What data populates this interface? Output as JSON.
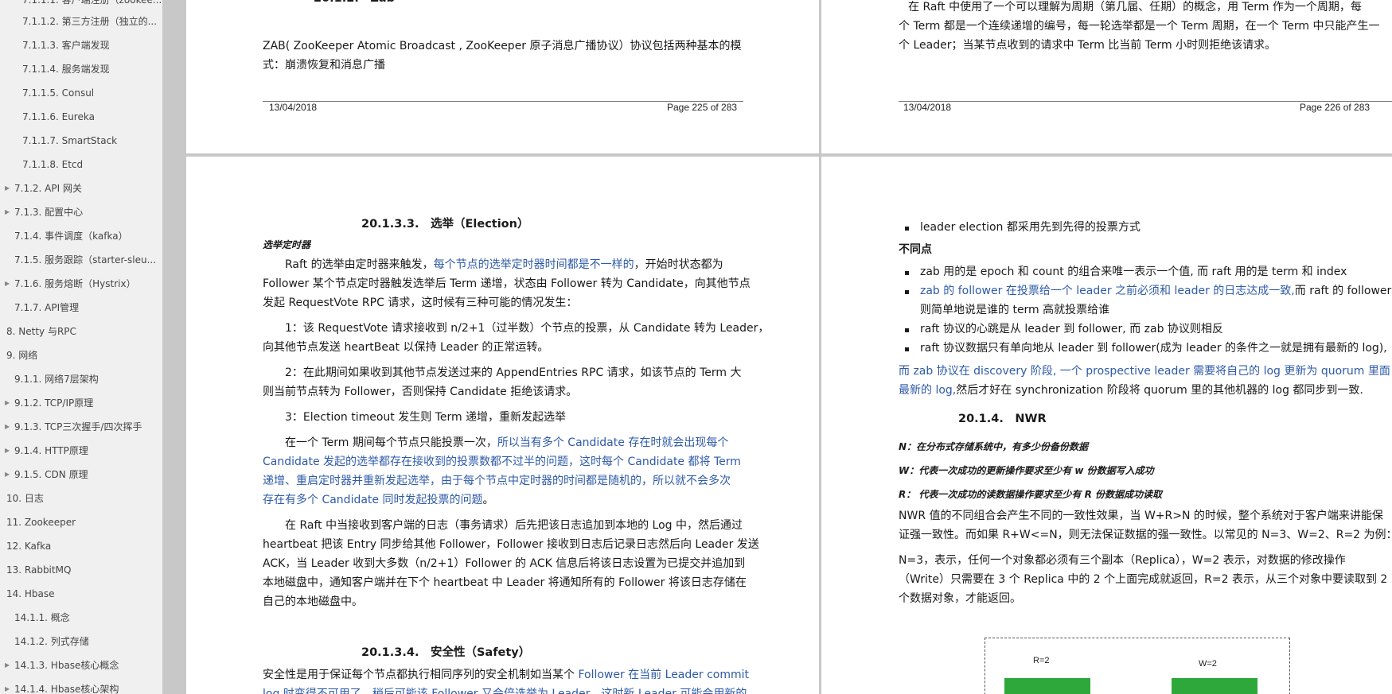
{
  "sidebar": {
    "items": [
      {
        "label": "7.1.1.2. 第三方注册（独立的...",
        "arrow": false
      },
      {
        "label": "7.1.1.3. 客户端发现",
        "arrow": false
      },
      {
        "label": "7.1.1.4. 服务端发现",
        "arrow": false
      },
      {
        "label": "7.1.1.5. Consul",
        "arrow": false
      },
      {
        "label": "7.1.1.6. Eureka",
        "arrow": false
      },
      {
        "label": "7.1.1.7. SmartStack",
        "arrow": false
      },
      {
        "label": "7.1.1.8. Etcd",
        "arrow": false
      },
      {
        "label": "7.1.2. API 网关",
        "arrow": true
      },
      {
        "label": "7.1.3. 配置中心",
        "arrow": true
      },
      {
        "label": "7.1.4. 事件调度（kafka）",
        "arrow": false
      },
      {
        "label": "7.1.5. 服务跟踪（starter-sleu...",
        "arrow": false
      },
      {
        "label": "7.1.6. 服务熔断（Hystrix）",
        "arrow": true
      },
      {
        "label": "7.1.7. API管理",
        "arrow": false
      },
      {
        "label": "8. Netty 与RPC",
        "arrow": false
      },
      {
        "label": "9. 网络",
        "arrow": false
      },
      {
        "label": "9.1.1. 网络7层架构",
        "arrow": false
      },
      {
        "label": "9.1.2. TCP/IP原理",
        "arrow": true
      },
      {
        "label": "9.1.3. TCP三次握手/四次挥手",
        "arrow": true
      },
      {
        "label": "9.1.4. HTTP原理",
        "arrow": true
      },
      {
        "label": "9.1.5. CDN 原理",
        "arrow": true
      },
      {
        "label": "10. 日志",
        "arrow": false
      },
      {
        "label": "11. Zookeeper",
        "arrow": false
      },
      {
        "label": "12. Kafka",
        "arrow": false
      },
      {
        "label": "13. RabbitMQ",
        "arrow": false
      },
      {
        "label": "14. Hbase",
        "arrow": false
      },
      {
        "label": "14.1.1. 概念",
        "arrow": false
      },
      {
        "label": "14.1.2. 列式存储",
        "arrow": false
      },
      {
        "label": "14.1.3. Hbase核心概念",
        "arrow": true
      },
      {
        "label": "14.1.4. Hbase核心架构",
        "arrow": true
      }
    ]
  },
  "page225": {
    "zab_line1": "ZAB( ZooKeeper Atomic Broadcast , ZooKeeper 原子消息广播协议）协议包括两种基本的模",
    "zab_line2": "式：崩溃恢复和消息广播",
    "date": "13/04/2018",
    "page_no": "Page 225 of 283"
  },
  "page226": {
    "line1": "在 Raft 中使用了一个可以理解为周期（第几届、任期）的概念，用 Term 作为一个周期，每",
    "line2": "个 Term 都是一个连续递增的编号，每一轮选举都是一个 Term 周期，在一个 Term 中只能产生一",
    "line3": "个 Leader；当某节点收到的请求中 Term 比当前 Term 小时则拒绝该请求。",
    "date": "13/04/2018",
    "page_no": "Page 226 of 283"
  },
  "page227": {
    "heading": "20.1.3.3.　选举（Election）",
    "subheading": "选举定时器",
    "p1_a": "Raft 的选举由定时器来触发，",
    "p1_b": "每个节点的选举定时器时间都是不一样的",
    "p1_c": "，开始时状态都为",
    "p1_l2": "Follower 某个节点定时器触发选举后 Term 递增，状态由 Follower 转为 Candidate，向其他节点",
    "p1_l3": "发起 RequestVote RPC 请求，这时候有三种可能的情况发生：",
    "p2_l1": "1：该 RequestVote 请求接收到 n/2+1（过半数）个节点的投票，从 Candidate 转为 Leader，",
    "p2_l2": "向其他节点发送 heartBeat 以保持 Leader 的正常运转。",
    "p3_l1": "2：在此期间如果收到其他节点发送过来的 AppendEntries RPC 请求，如该节点的 Term 大",
    "p3_l2": "则当前节点转为 Follower，否则保持 Candidate 拒绝该请求。",
    "p4_l1": "3：Election timeout 发生则 Term 递增，重新发起选举",
    "p5_a": "在一个 Term 期间每个节点只能投票一次，",
    "p5_b": "所以当有多个 Candidate 存在时就会出现每个",
    "p5_l2": "Candidate 发起的选举都存在接收到的投票数都不过半的问题，这时每个 Candidate 都将 Term",
    "p5_l3": "递增、重启定时器并重新发起选举，由于每个节点中定时器的时间都是随机的，所以就不会多次",
    "p5_l4": "存在有多个 Candidate 同时发起投票的问题",
    "p5_end": "。",
    "p6_l1": "在 Raft 中当接收到客户端的日志（事务请求）后先把该日志追加到本地的 Log 中，然后通过",
    "p6_l2": "heartbeat 把该 Entry 同步给其他 Follower，Follower 接收到日志后记录日志然后向 Leader 发送",
    "p6_l3": "ACK，当 Leader 收到大多数（n/2+1）Follower 的 ACK 信息后将该日志设置为已提交并追加到",
    "p6_l4": "本地磁盘中，通知客户端并在下个 heartbeat 中 Leader 将通知所有的 Follower 将该日志存储在",
    "p6_l5": "自己的本地磁盘中。",
    "heading2": "20.1.3.4.　安全性（Safety）",
    "p7_a": "安全性是用于保证每个节点都执行相同序列的安全机制如当某个 ",
    "p7_b": "Follower 在当前 Leader commit",
    "p7_l2": "log 时变得不可用了，稍后可能该 Follower 又会倍选举为 Leader，这时新 Leader 可能会用新的"
  },
  "page228": {
    "b1": "leader election 都采用先到先得的投票方式",
    "diff_heading": "不同点",
    "b2": "zab 用的是 epoch 和 count 的组合来唯一表示一个值, 而 raft 用的是 term 和 index",
    "b3_a": "zab 的 follower 在投票给一个 leader 之前必须和 leader 的日志达成一致,",
    "b3_b": "而 raft 的 follower",
    "b3_l2": "则简单地说是谁的 term 高就投票给谁",
    "b4": "raft 协议的心跳是从 leader 到 follower, 而 zab 协议则相反",
    "b5": "raft 协议数据只有单向地从 leader 到 follower(成为 leader 的条件之一就是拥有最新的 log),",
    "p1_l1": "而 zab 协议在 discovery 阶段, 一个 prospective leader 需要将自己的 log 更新为 quorum 里面",
    "p1_l2a": "最新的 log,",
    "p1_l2b": "然后才好在 synchronization 阶段将 quorum 里的其他机器的 log 都同步到一致.",
    "heading": "20.1.4.　NWR",
    "n_line": "N：在分布式存储系统中，有多少份备份数据",
    "w_line": "W：代表一次成功的更新操作要求至少有 w 份数据写入成功",
    "r_line": "R：  代表一次成功的读数据操作要求至少有 R 份数据成功读取",
    "p2_l1": "NWR 值的不同组合会产生不同的一致性效果，当 W+R>N 的时候，整个系统对于客户端来讲能保",
    "p2_l2": "证强一致性。而如果 R+W<=N，则无法保证数据的强一致性。以常见的 N=3、W=2、R=2 为例：",
    "p3_l1": "N=3，表示，任何一个对象都必须有三个副本（Replica），W=2 表示，对数据的修改操作",
    "p3_l2": "（Write）只需要在 3 个 Replica 中的 2 个上面完成就返回，R=2 表示，从三个对象中要读取到 2",
    "p3_l3": "个数据对象，才能返回。",
    "fig_r": "R=2",
    "fig_w": "W=2"
  },
  "colors": {
    "link_blue": "#2e5aa8",
    "fig_green": "#2ea83a"
  }
}
